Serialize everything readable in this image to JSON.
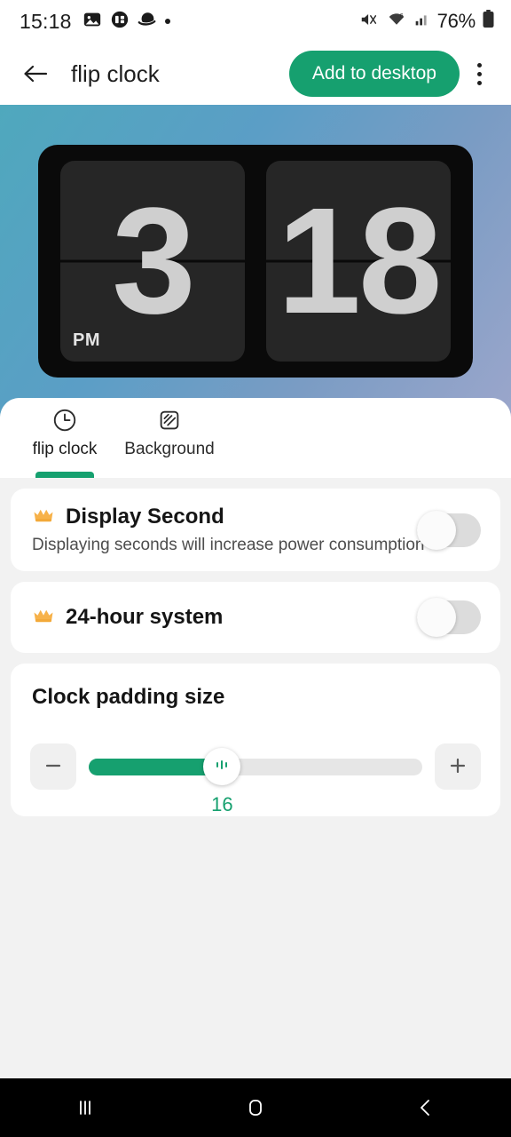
{
  "status_bar": {
    "time": "15:18",
    "left_icons": [
      "image-icon",
      "split-screen-icon",
      "saturn-icon",
      "dot-indicator"
    ],
    "right_icons": [
      "mute-icon",
      "wifi-icon",
      "cellular-signal-icon"
    ],
    "battery_percent": "76%"
  },
  "app_bar": {
    "back_icon": "back-arrow-icon",
    "title": "flip clock",
    "add_button_label": "Add to desktop",
    "overflow_icon": "kebab-menu-icon"
  },
  "preview": {
    "widget_type": "flip-clock",
    "hour": "3",
    "minute": "18",
    "ampm": "PM",
    "background_gradient_start": "#4fa8bd",
    "background_gradient_end": "#9ba6cb",
    "panel_color": "#262626",
    "frame_color": "#0a0a0a",
    "digit_color": "#cfcfcf"
  },
  "tabs": [
    {
      "label": "flip clock",
      "icon": "clock-icon",
      "active": true
    },
    {
      "label": "Background",
      "icon": "pattern-square-icon",
      "active": false
    }
  ],
  "settings": {
    "display_second": {
      "title": "Display Second",
      "subtitle": "Displaying seconds will increase power consumption",
      "premium_icon": "crown-icon",
      "toggle_state": "off"
    },
    "hour_system": {
      "title": "24-hour system",
      "premium_icon": "crown-icon",
      "toggle_state": "off"
    },
    "padding": {
      "title": "Clock padding size",
      "value": "16",
      "fill_percent": 40,
      "decrease_icon": "minus-icon",
      "increase_icon": "plus-icon",
      "thumb_icon": "sliders-icon",
      "accent_color": "#16a06f"
    }
  },
  "nav_bar": {
    "recents_icon": "recents-icon",
    "home_icon": "home-icon",
    "back_icon": "back-chevron-icon"
  }
}
